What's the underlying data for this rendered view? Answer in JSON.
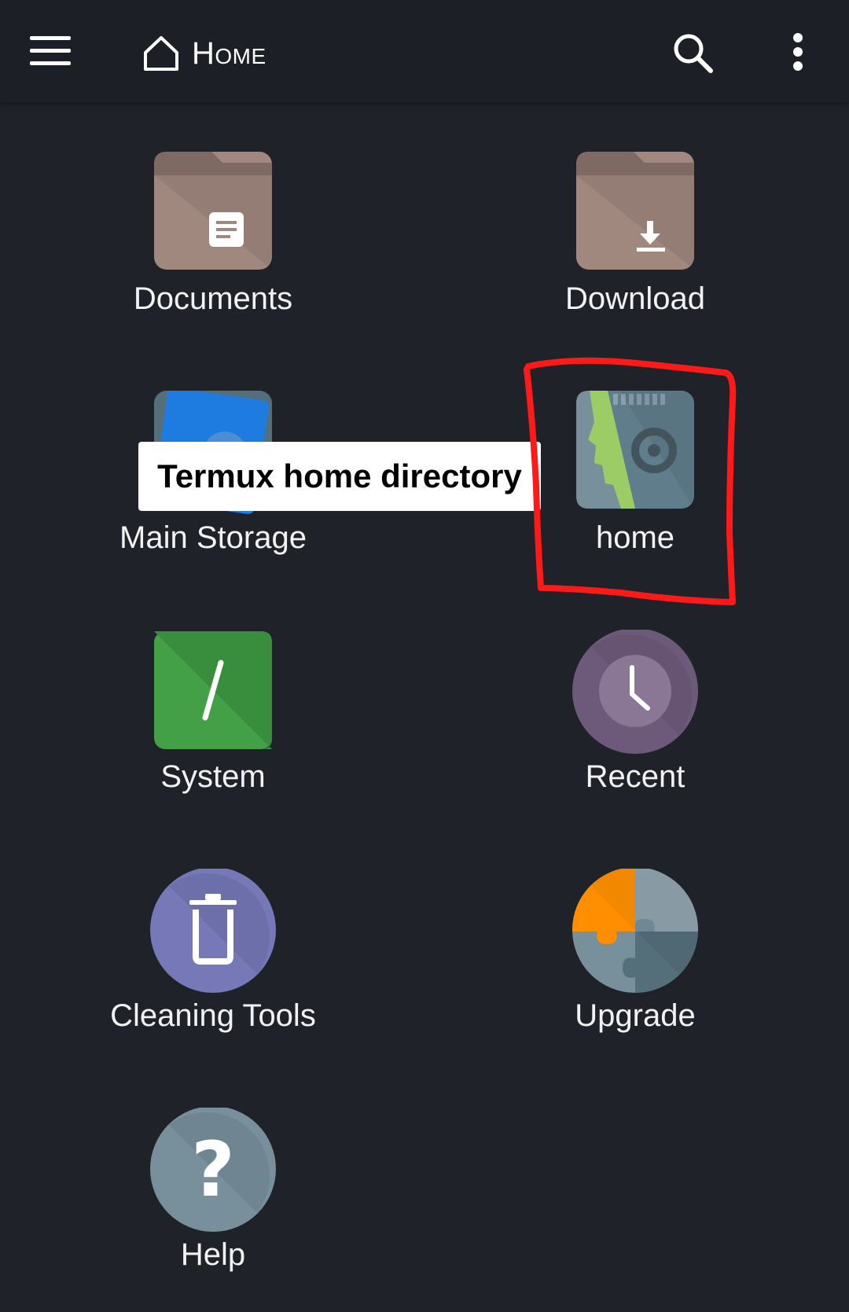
{
  "appbar": {
    "title": "Home",
    "icons": {
      "menu": "hamburger-menu-icon",
      "home": "home-outline-icon",
      "search": "search-icon",
      "more": "more-vertical-icon"
    }
  },
  "tiles": [
    {
      "label": "Documents",
      "icon": "documents-folder-icon"
    },
    {
      "label": "Download",
      "icon": "download-folder-icon"
    },
    {
      "label": "Main Storage",
      "icon": "storage-card-icon"
    },
    {
      "label": "home",
      "icon": "sd-card-icon"
    },
    {
      "label": "System",
      "icon": "system-root-icon"
    },
    {
      "label": "Recent",
      "icon": "clock-icon"
    },
    {
      "label": "Cleaning Tools",
      "icon": "trash-icon"
    },
    {
      "label": "Upgrade",
      "icon": "puzzle-icon"
    },
    {
      "label": "Help",
      "icon": "help-question-icon"
    }
  ],
  "tooltip": {
    "text": "Termux home directory"
  },
  "colors": {
    "background": "#1f2229",
    "appbar": "#1c1f25",
    "folder": "#a1887f",
    "annotation": "#ff1a1a"
  }
}
